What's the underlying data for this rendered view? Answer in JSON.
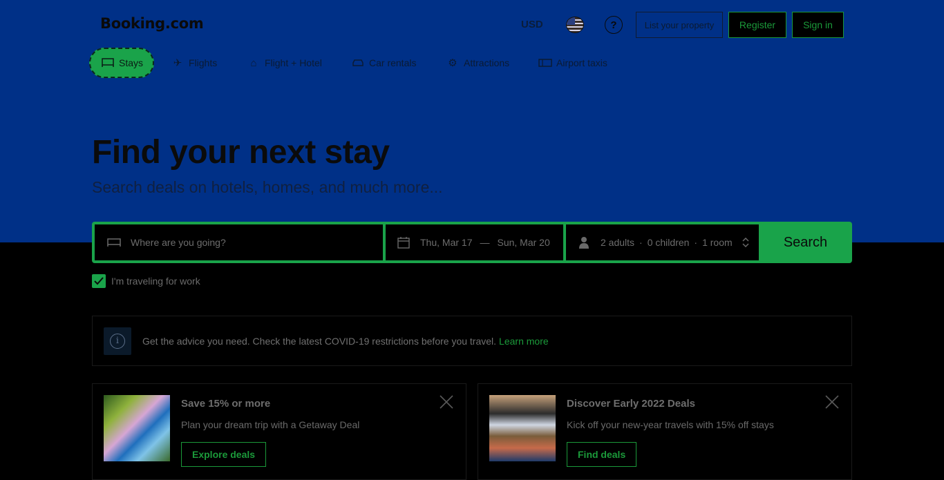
{
  "header": {
    "logo": "Booking.com",
    "currency": "USD",
    "list_property": "List your property",
    "register": "Register",
    "sign_in": "Sign in",
    "help_glyph": "?"
  },
  "nav": [
    {
      "label": "Stays",
      "icon": "bed-icon"
    },
    {
      "label": "Flights",
      "icon": "plane-icon"
    },
    {
      "label": "Flight + Hotel",
      "icon": "flight-hotel-icon"
    },
    {
      "label": "Car rentals",
      "icon": "car-icon"
    },
    {
      "label": "Attractions",
      "icon": "attractions-icon"
    },
    {
      "label": "Airport taxis",
      "icon": "taxi-icon"
    }
  ],
  "hero": {
    "title": "Find your next stay",
    "subtitle": "Search deals on hotels, homes, and much more..."
  },
  "search": {
    "destination_placeholder": "Where are you going?",
    "checkin": "Thu, Mar 17",
    "date_sep": "—",
    "checkout": "Sun, Mar 20",
    "adults": "2 adults",
    "children": "0 children",
    "rooms": "1 room",
    "separator": "·",
    "button": "Search"
  },
  "work_travel": {
    "label": "I'm traveling for work",
    "checked": true
  },
  "covid": {
    "text": "Get the advice you need. Check the latest COVID-19 restrictions before you travel.",
    "link": "Learn more"
  },
  "cards": [
    {
      "title": "Save 15% or more",
      "desc": "Plan your dream trip with a Getaway Deal",
      "button": "Explore deals"
    },
    {
      "title": "Discover Early 2022 Deals",
      "desc": "Kick off your new-year travels with 15% off stays",
      "button": "Find deals"
    }
  ],
  "colors": {
    "hero_bg": "#003087",
    "accent_green": "#1aa34a",
    "page_bg": "#000000"
  }
}
